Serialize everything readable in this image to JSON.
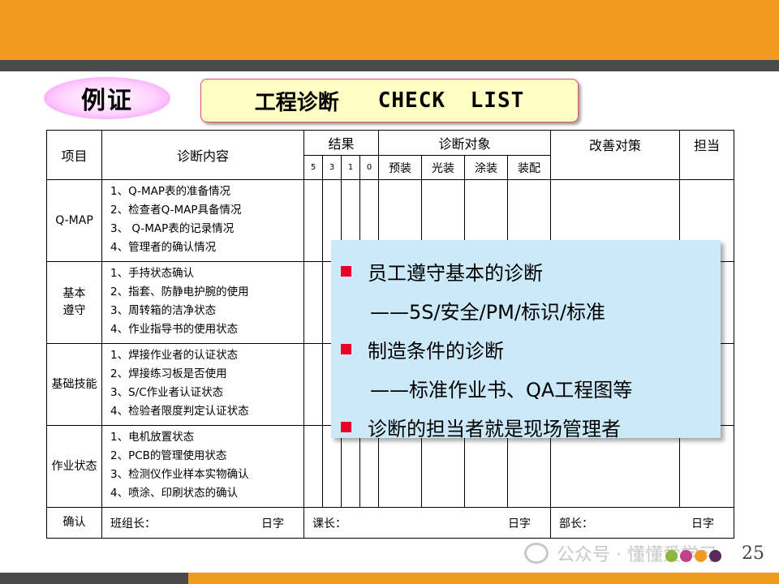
{
  "tag": "例证",
  "title": {
    "cn": "工程诊断",
    "en": "CHECK LIST"
  },
  "table": {
    "headers": {
      "item": "项目",
      "content": "诊断内容",
      "result": "结果",
      "target": "诊断对象",
      "measure": "改善对策",
      "owner": "担当"
    },
    "result_scores": [
      "5",
      "3",
      "1",
      "0"
    ],
    "targets": [
      "预装",
      "光装",
      "涂装",
      "装配"
    ],
    "rows": [
      {
        "item": "Q-MAP",
        "lines": [
          "1、Q-MAP表的准备情况",
          "2、检查者Q-MAP具备情况",
          "3、 Q-MAP表的记录情况",
          "4、管理者的确认情况"
        ]
      },
      {
        "item": "基本遵守",
        "lines": [
          "1、手持状态确认",
          "2、指套、防静电护腕的使用",
          "3、周转箱的洁净状态",
          "4、作业指导书的使用状态"
        ]
      },
      {
        "item": "基础技能",
        "lines": [
          "1、焊接作业者的认证状态",
          "2、焊接练习板是否使用",
          "3、S/C作业者认证状态",
          "4、检验者限度判定认证状态"
        ]
      },
      {
        "item": "作业状态",
        "lines": [
          "1、电机放置状态",
          "2、PCB的管理使用状态",
          "3、检测仪作业样本实物确认",
          "4、喷涂、印刷状态的确认"
        ]
      }
    ],
    "confirm": {
      "label": "确认",
      "leader": "班组长：",
      "leader_date": "日字",
      "section": "课长：",
      "section_date": "日字",
      "dept": "部长：",
      "dept_date": "日字"
    }
  },
  "callout": [
    "员工遵守基本的诊断",
    "——5S/安全/PM/标识/标准",
    "制造条件的诊断",
    "——标准作业书、QA工程图等",
    "诊断的担当者就是现场管理者"
  ],
  "watermark": "公众号 · 懂懂爱学习",
  "page_number": "25",
  "colors": {
    "orange": "#f29a1f",
    "gray": "#4a4a4a",
    "callout_bg": "#cce9f9",
    "bullet": "#e8002a",
    "title_bg": "#ffffc4"
  }
}
